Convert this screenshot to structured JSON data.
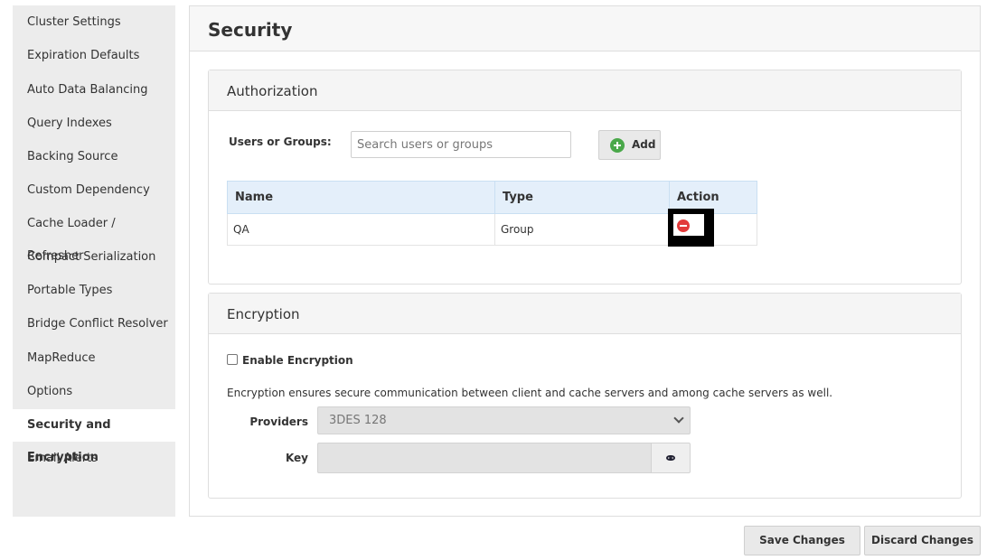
{
  "sidebar": {
    "items": [
      {
        "label": "Cluster Settings"
      },
      {
        "label": "Expiration Defaults"
      },
      {
        "label": "Auto Data Balancing"
      },
      {
        "label": "Query Indexes"
      },
      {
        "label": "Backing Source"
      },
      {
        "label": "Custom Dependency"
      },
      {
        "label": "Cache Loader / Refresher"
      },
      {
        "label": "Compact Serialization"
      },
      {
        "label": "Portable Types"
      },
      {
        "label": "Bridge Conflict Resolver"
      },
      {
        "label": "MapReduce"
      },
      {
        "label": "Options"
      },
      {
        "label": "Security and Encryption"
      },
      {
        "label": "Email Alerts"
      }
    ],
    "active_item": "Security and Encryption"
  },
  "main": {
    "title": "Security",
    "authorization": {
      "title": "Authorization",
      "users_label": "Users or Groups:",
      "search_placeholder": "Search users or groups",
      "add_label": "Add",
      "table": {
        "headers": [
          "Name",
          "Type",
          "Action"
        ],
        "rows": [
          {
            "name": "QA",
            "type": "Group",
            "action_icon": "remove-icon"
          }
        ]
      }
    },
    "encryption": {
      "title": "Encryption",
      "enable_label": "Enable Encryption",
      "enable_checked": false,
      "description": "Encryption ensures secure communication between client and cache servers and among cache servers as well.",
      "providers_label": "Providers",
      "providers_value": "3DES 128",
      "key_label": "Key",
      "key_value": ""
    }
  },
  "footer": {
    "save_label": "Save Changes",
    "discard_label": "Discard Changes"
  },
  "colors": {
    "table_header_bg": "#e4effa",
    "add_icon": "#4aa84a",
    "remove_icon": "#e23a3a"
  }
}
